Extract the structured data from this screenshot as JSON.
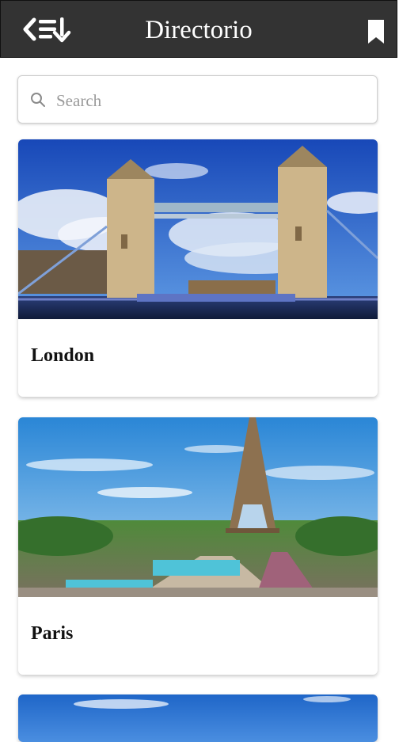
{
  "header": {
    "title": "Directorio",
    "back_icon": "back-list-icon",
    "bookmark_icon": "bookmark-icon"
  },
  "search": {
    "placeholder": "Search",
    "value": "",
    "icon": "search-icon"
  },
  "cities": [
    {
      "name": "London"
    },
    {
      "name": "Paris"
    },
    {
      "name": ""
    }
  ],
  "colors": {
    "header_bg": "#333333",
    "header_text": "#ffffff",
    "sky_blue": "#2f6fd0",
    "card_label": "#111111"
  }
}
